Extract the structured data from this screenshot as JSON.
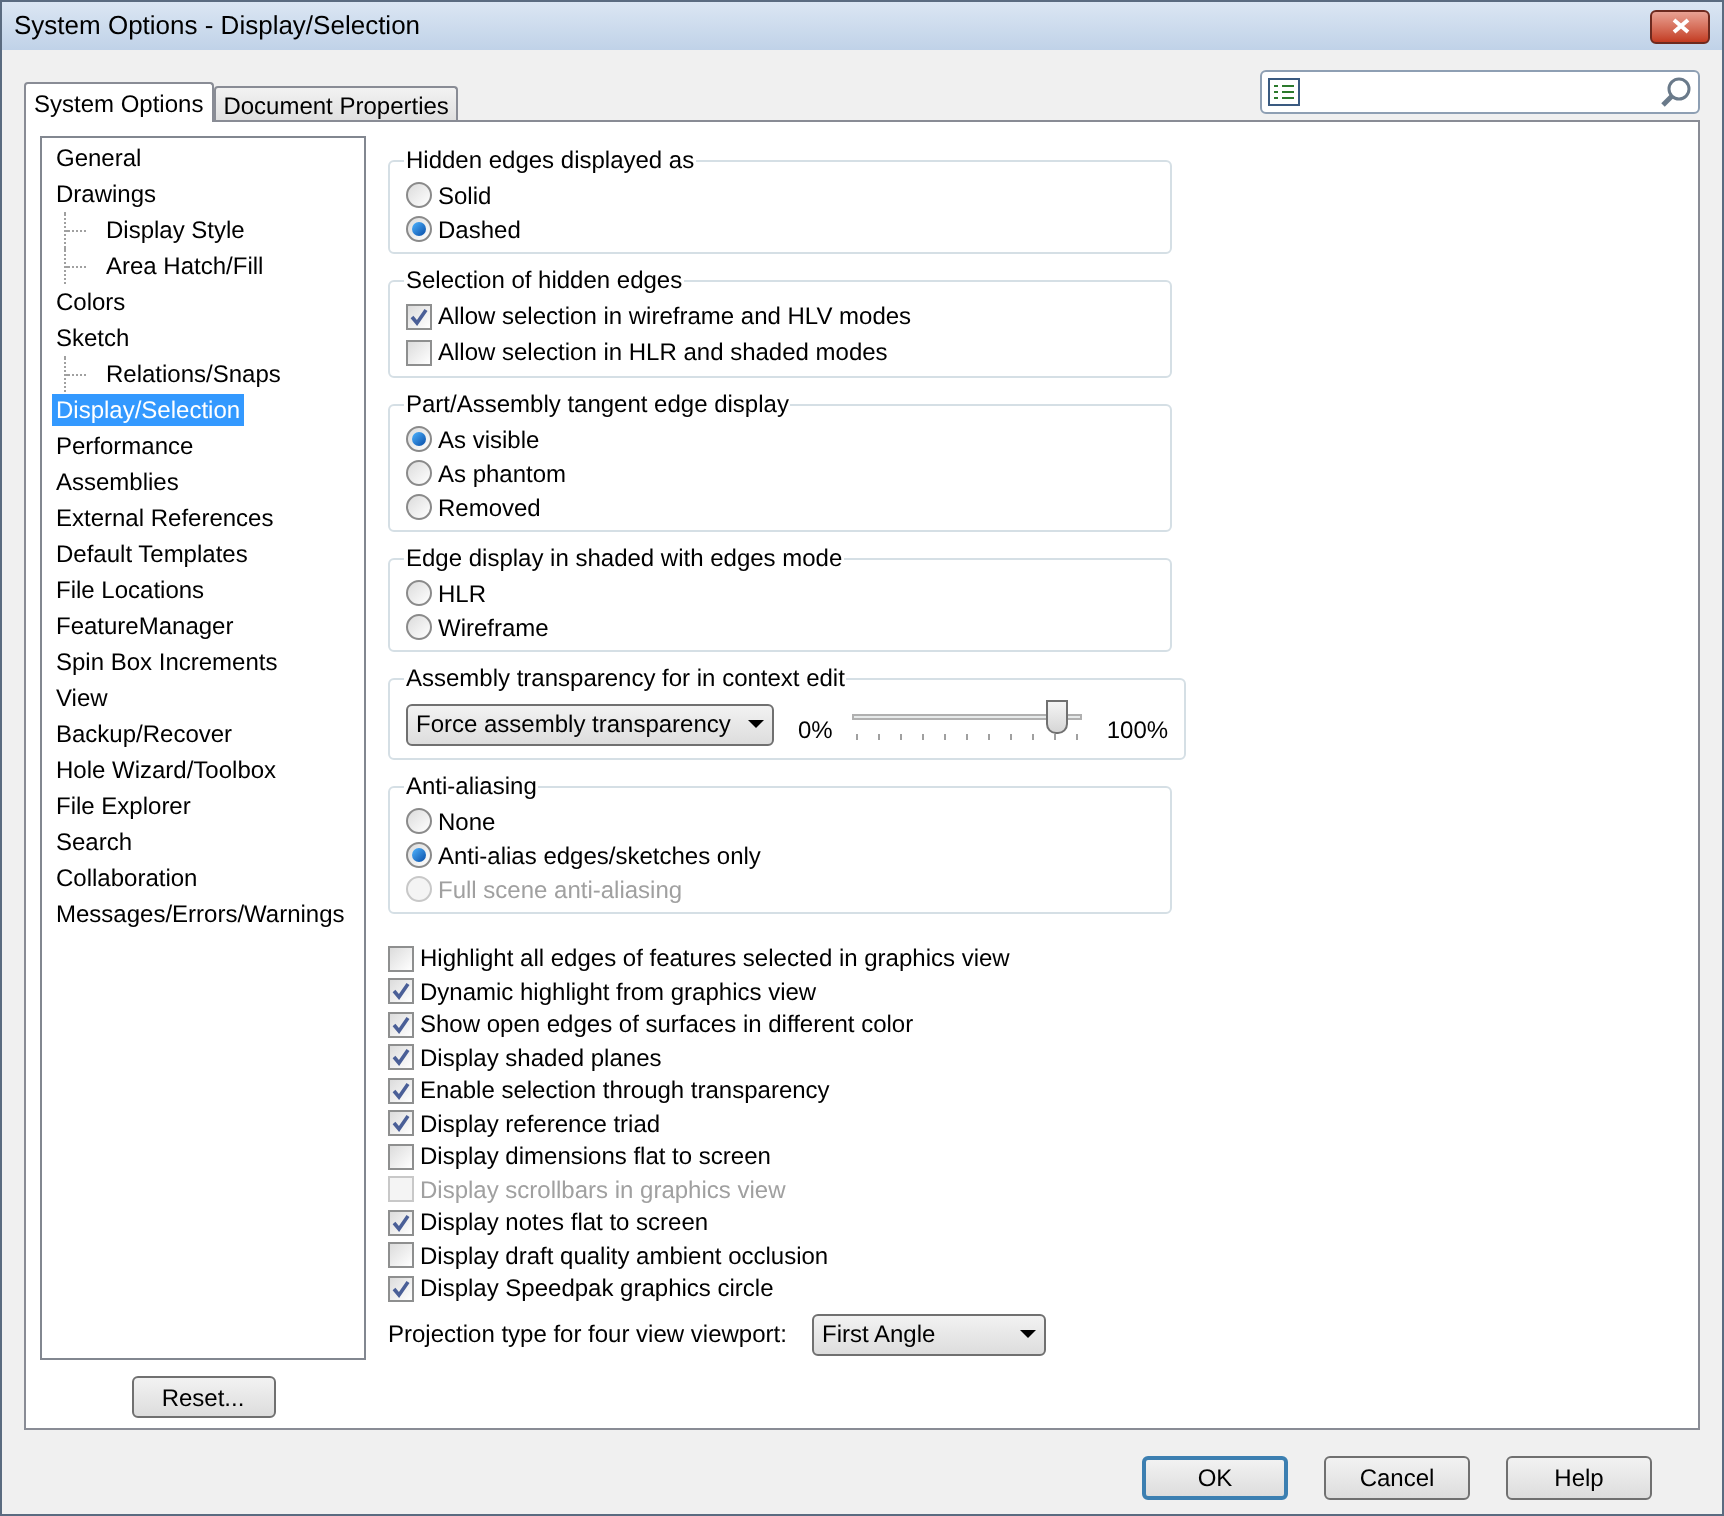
{
  "window": {
    "title": "System Options - Display/Selection"
  },
  "tabs": [
    {
      "label": "System Options",
      "selected": true
    },
    {
      "label": "Document Properties",
      "selected": false
    }
  ],
  "tree": [
    {
      "label": "General",
      "selected": false
    },
    {
      "label": "Drawings",
      "selected": false,
      "children": [
        {
          "label": "Display Style",
          "selected": false
        },
        {
          "label": "Area Hatch/Fill",
          "selected": false
        }
      ]
    },
    {
      "label": "Colors",
      "selected": false
    },
    {
      "label": "Sketch",
      "selected": false,
      "children": [
        {
          "label": "Relations/Snaps",
          "selected": false
        }
      ]
    },
    {
      "label": "Display/Selection",
      "selected": true
    },
    {
      "label": "Performance",
      "selected": false
    },
    {
      "label": "Assemblies",
      "selected": false
    },
    {
      "label": "External References",
      "selected": false
    },
    {
      "label": "Default Templates",
      "selected": false
    },
    {
      "label": "File Locations",
      "selected": false
    },
    {
      "label": "FeatureManager",
      "selected": false
    },
    {
      "label": "Spin Box Increments",
      "selected": false
    },
    {
      "label": "View",
      "selected": false
    },
    {
      "label": "Backup/Recover",
      "selected": false
    },
    {
      "label": "Hole Wizard/Toolbox",
      "selected": false
    },
    {
      "label": "File Explorer",
      "selected": false
    },
    {
      "label": "Search",
      "selected": false
    },
    {
      "label": "Collaboration",
      "selected": false
    },
    {
      "label": "Messages/Errors/Warnings",
      "selected": false
    }
  ],
  "reset_button": "Reset...",
  "groups": [
    {
      "title": "Hidden edges displayed as",
      "items": [
        {
          "kind": "radio",
          "label": "Solid",
          "selected": false,
          "disabled": false
        },
        {
          "kind": "radio",
          "label": "Dashed",
          "selected": true,
          "disabled": false
        }
      ]
    },
    {
      "title": "Selection of hidden edges",
      "items": [
        {
          "kind": "checkbox",
          "label": "Allow selection in wireframe and HLV modes",
          "checked": true,
          "disabled": false
        },
        {
          "kind": "checkbox",
          "label": "Allow selection in HLR and shaded modes",
          "checked": false,
          "disabled": false
        }
      ]
    },
    {
      "title": "Part/Assembly tangent edge display",
      "items": [
        {
          "kind": "radio",
          "label": "As visible",
          "selected": true,
          "disabled": false
        },
        {
          "kind": "radio",
          "label": "As phantom",
          "selected": false,
          "disabled": false
        },
        {
          "kind": "radio",
          "label": "Removed",
          "selected": false,
          "disabled": false
        }
      ]
    },
    {
      "title": "Edge display in shaded with edges mode",
      "items": [
        {
          "kind": "radio",
          "label": "HLR",
          "selected": false,
          "disabled": false
        },
        {
          "kind": "radio",
          "label": "Wireframe",
          "selected": false,
          "disabled": false
        }
      ]
    },
    {
      "title": "Assembly transparency for in context edit",
      "items": [
        {
          "kind": "transparency",
          "value": "Force assembly transparency",
          "min_label": "0%",
          "max_label": "100%",
          "level": 0.88
        }
      ]
    },
    {
      "title": "Anti-aliasing",
      "items": [
        {
          "kind": "radio",
          "label": "None",
          "selected": false,
          "disabled": false
        },
        {
          "kind": "radio",
          "label": "Anti-alias edges/sketches only",
          "selected": true,
          "disabled": false
        },
        {
          "kind": "radio",
          "label": "Full scene anti-aliasing",
          "selected": false,
          "disabled": true
        }
      ]
    }
  ],
  "checkboxes": [
    {
      "label": "Highlight all edges of features selected in graphics view",
      "checked": false,
      "disabled": false
    },
    {
      "label": "Dynamic highlight from graphics view",
      "checked": true,
      "disabled": false
    },
    {
      "label": "Show open edges of surfaces in different color",
      "checked": true,
      "disabled": false
    },
    {
      "label": "Display shaded planes",
      "checked": true,
      "disabled": false
    },
    {
      "label": "Enable selection through transparency",
      "checked": true,
      "disabled": false
    },
    {
      "label": "Display reference triad",
      "checked": true,
      "disabled": false
    },
    {
      "label": "Display dimensions flat to screen",
      "checked": false,
      "disabled": false
    },
    {
      "label": "Display scrollbars in graphics view",
      "checked": false,
      "disabled": true
    },
    {
      "label": "Display notes flat to screen",
      "checked": true,
      "disabled": false
    },
    {
      "label": "Display draft quality ambient occlusion",
      "checked": false,
      "disabled": false
    },
    {
      "label": "Display Speedpak graphics circle",
      "checked": true,
      "disabled": false
    }
  ],
  "projection": {
    "label": "Projection type for four view viewport:",
    "value": "First Angle"
  },
  "buttons": [
    {
      "label": "OK",
      "selected": true
    },
    {
      "label": "Cancel",
      "selected": false
    },
    {
      "label": "Help",
      "selected": false
    }
  ]
}
